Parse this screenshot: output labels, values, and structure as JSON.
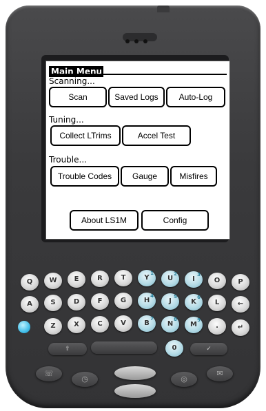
{
  "menu": {
    "title": "Main Menu",
    "sections": [
      {
        "label": "Scanning...",
        "buttons": [
          "Scan",
          "Saved Logs",
          "Auto-Log"
        ]
      },
      {
        "label": "Tuning...",
        "buttons": [
          "Collect LTrims",
          "Accel Test"
        ]
      },
      {
        "label": "Trouble...",
        "buttons": [
          "Trouble Codes",
          "Gauge",
          "Misfires"
        ]
      }
    ],
    "bottom_buttons": [
      "About LS1M",
      "Config"
    ]
  },
  "keyboard": {
    "row1": [
      {
        "key": "Q",
        "sub": ""
      },
      {
        "key": "W",
        "sub": ""
      },
      {
        "key": "E",
        "sub": ""
      },
      {
        "key": "R",
        "sub": ""
      },
      {
        "key": "T",
        "sub": ""
      },
      {
        "key": "Y",
        "sub": "1"
      },
      {
        "key": "U",
        "sub": "2"
      },
      {
        "key": "I",
        "sub": "3"
      },
      {
        "key": "O",
        "sub": ""
      },
      {
        "key": "P",
        "sub": ""
      }
    ],
    "row2": [
      {
        "key": "A",
        "sub": ""
      },
      {
        "key": "S",
        "sub": ""
      },
      {
        "key": "D",
        "sub": ""
      },
      {
        "key": "F",
        "sub": ""
      },
      {
        "key": "G",
        "sub": ""
      },
      {
        "key": "H",
        "sub": "4"
      },
      {
        "key": "J",
        "sub": "5"
      },
      {
        "key": "K",
        "sub": "6"
      },
      {
        "key": "L",
        "sub": ""
      },
      {
        "key": "←",
        "sub": ""
      }
    ],
    "row3": [
      {
        "key": "Z",
        "sub": ""
      },
      {
        "key": "X",
        "sub": ""
      },
      {
        "key": "C",
        "sub": ""
      },
      {
        "key": "V",
        "sub": ""
      },
      {
        "key": "B",
        "sub": "7"
      },
      {
        "key": "N",
        "sub": "8"
      },
      {
        "key": "M",
        "sub": "9"
      },
      {
        "key": ".",
        "sub": ""
      },
      {
        "key": "↵",
        "sub": ""
      }
    ],
    "zero_key": "0"
  }
}
